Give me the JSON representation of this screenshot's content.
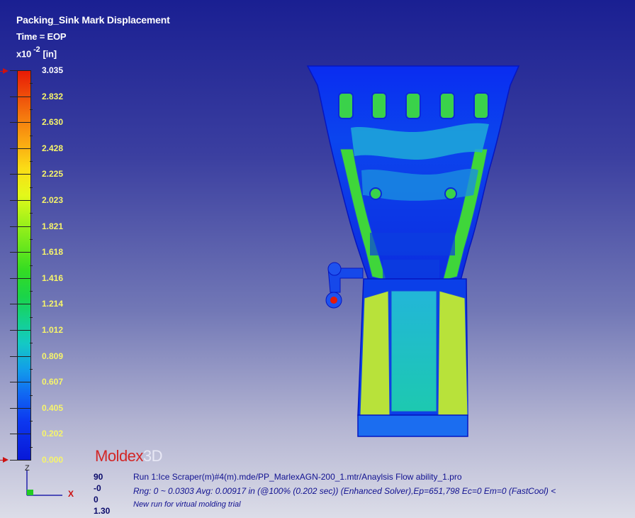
{
  "header": {
    "title": "Packing_Sink Mark Displacement",
    "time": "Time = EOP",
    "unit_prefix": "x10",
    "unit_exp": "-2",
    "unit": "[in]"
  },
  "legend": {
    "values": [
      "3.035",
      "2.832",
      "2.630",
      "2.428",
      "2.225",
      "2.023",
      "1.821",
      "1.618",
      "1.416",
      "1.214",
      "1.012",
      "0.809",
      "0.607",
      "0.405",
      "0.202",
      "0.000"
    ],
    "max_color": "#e81a06",
    "min_color": "#0818d8"
  },
  "brand": {
    "part1": "Moldex",
    "part2": "3D",
    "color": "#d22626"
  },
  "view": {
    "values": [
      "90",
      "-0",
      "0",
      "1.30"
    ]
  },
  "axis": {
    "z": "Z",
    "x": "X"
  },
  "info": {
    "run": "Run 1:Ice Scraper(m)#4(m).mde/PP_MarlexAGN-200_1.mtr/Anaylsis Flow ability_1.pro",
    "range": "Rng: 0 ~ 0.0303   Avg: 0.00917 in  (@100% (0.202 sec)) (Enhanced Solver),Ep=651,798 Ec=0 Em=0 (FastCool) <",
    "note": "New run for virtual molding trial"
  }
}
